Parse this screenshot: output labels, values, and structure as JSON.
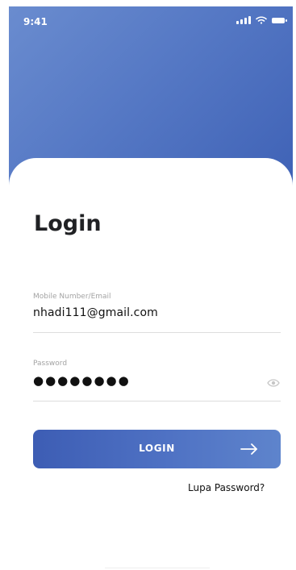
{
  "status_bar": {
    "time": "9:41",
    "signal_icon": "signal-icon",
    "wifi_icon": "wifi-icon",
    "battery_icon": "battery-icon"
  },
  "screen": {
    "title": "Login"
  },
  "form": {
    "email": {
      "label": "Mobile Number/Email",
      "value": "nhadi111@gmail.com"
    },
    "password": {
      "label": "Password",
      "value": "●●●●●●●●",
      "visibility_icon": "eye-icon"
    }
  },
  "actions": {
    "login_label": "LOGIN",
    "login_icon": "arrow-right-icon",
    "forgot_password": "Lupa Password?"
  },
  "colors": {
    "primary": "#4f72c4",
    "text": "#111111",
    "muted": "#a3a3a3"
  }
}
